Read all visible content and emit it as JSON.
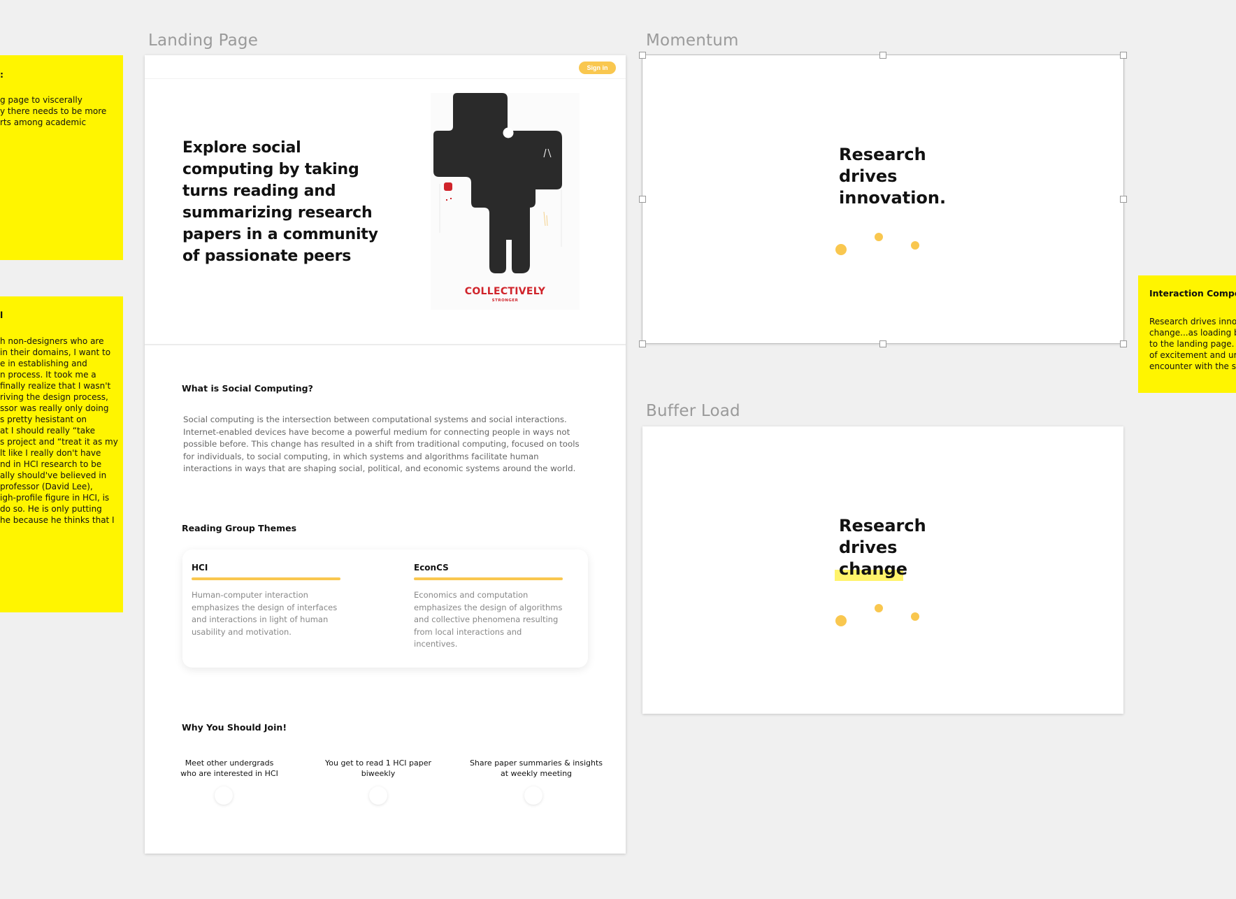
{
  "canvas": {
    "frames": {
      "landing": "Landing Page",
      "momentum": "Momentum",
      "buffer": "Buffer Load"
    }
  },
  "sticky_notes": {
    "note1": {
      "title": ":",
      "body": "g page to viscerally\ny there needs to be more\nrts among academic"
    },
    "note2": {
      "title": "l",
      "body": "h non-designers who are\n in their domains, I want to\ne in establishing and\nn process. It took me a\n finally realize that I wasn't\nriving the design process,\nssor was really only doing\ns pretty hesistant on\nat I should really “take\ns project and “treat it as my\nlt like I really don't have\nnd in HCI research to be\nally should've believed in\n professor (David Lee),\nigh-profile figure in HCI, is\n do so. He is only putting\nhe because he thinks that I"
    },
    "note3": {
      "title": "Interaction Compon",
      "body": "Research drives innov\nchange...as loading b\nto the landing page. V\nof excitement and urg\nencounter with the sit"
    }
  },
  "landing": {
    "signin_label": "Sign in",
    "hero_title": "Explore social computing by taking turns reading and summarizing research papers in a community of passionate peers",
    "poster": {
      "title": "COLLECTIVELY",
      "subtitle": "STRONGER",
      "ink_color": "#2a2a2a",
      "accent_color": "#d0242b"
    },
    "what_is": {
      "heading": "What is Social Computing?",
      "body": "Social computing is the intersection between computational systems and social interactions. Internet-enabled devices have become a powerful medium for connecting people in ways not possible before. This change has resulted in a shift from traditional computing, focused on tools for individuals, to social computing, in which systems and algorithms facilitate human interactions in ways that are shaping social, political, and economic systems around the world."
    },
    "themes": {
      "heading": "Reading Group Themes",
      "items": [
        {
          "title": "HCI",
          "desc": "Human-computer interaction emphasizes the design of interfaces and interactions in light of human usability and motivation."
        },
        {
          "title": "EconCS",
          "desc": "Economics and computation emphasizes the design of algorithms and collective phenomena resulting from local interactions and incentives."
        }
      ]
    },
    "join": {
      "heading": "Why You Should Join!",
      "items": [
        "Meet other undergrads who are interested in HCI",
        "You get to read 1 HCI paper biweekly",
        "Share paper summaries & insights at weekly meeting"
      ]
    }
  },
  "momentum": {
    "line1": "Research",
    "line2": "drives",
    "line3": "innovation."
  },
  "buffer": {
    "line1": "Research",
    "line2": "drives",
    "line3": "change"
  },
  "colors": {
    "accent": "#f9c74f",
    "sticky": "#fff500",
    "highlight": "#fff36b"
  }
}
